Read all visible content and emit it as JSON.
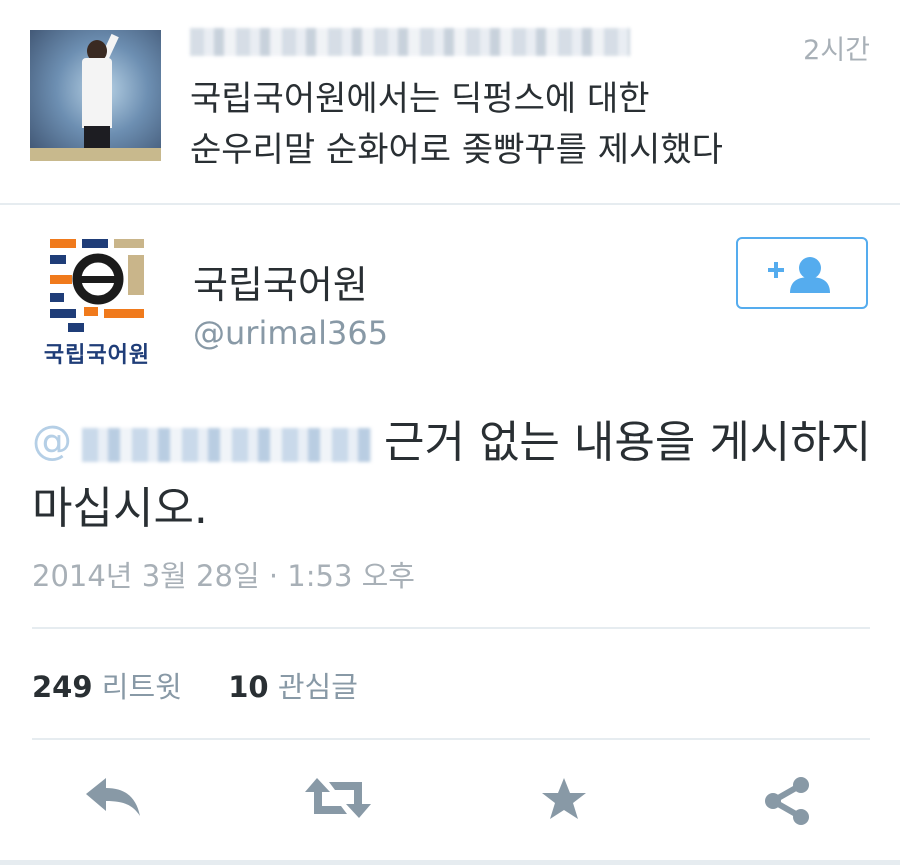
{
  "reply_tweet": {
    "time": "2시간",
    "text_line1": "국립국어원에서는 딕펑스에 대한",
    "text_line2": "순우리말 순화어로 좆빵꾸를 제시했다"
  },
  "main_tweet": {
    "logo_text": "국립국어원",
    "display_name": "국립국어원",
    "handle": "@urimal365",
    "mention_prefix": "@",
    "body": "근거 없는 내용을 게시하지 마십시오.",
    "date": "2014년 3월 28일 · 1:53 오후",
    "stats": {
      "retweets_count": "249",
      "retweets_label": "리트윗",
      "favorites_count": "10",
      "favorites_label": "관심글"
    }
  },
  "icons": {
    "follow": "add-user-icon",
    "reply": "reply-icon",
    "retweet": "retweet-icon",
    "favorite": "star-icon",
    "share": "share-icon"
  },
  "colors": {
    "accent": "#55acee",
    "action_icon": "#8899a6",
    "muted_text": "#a8b0b7"
  }
}
